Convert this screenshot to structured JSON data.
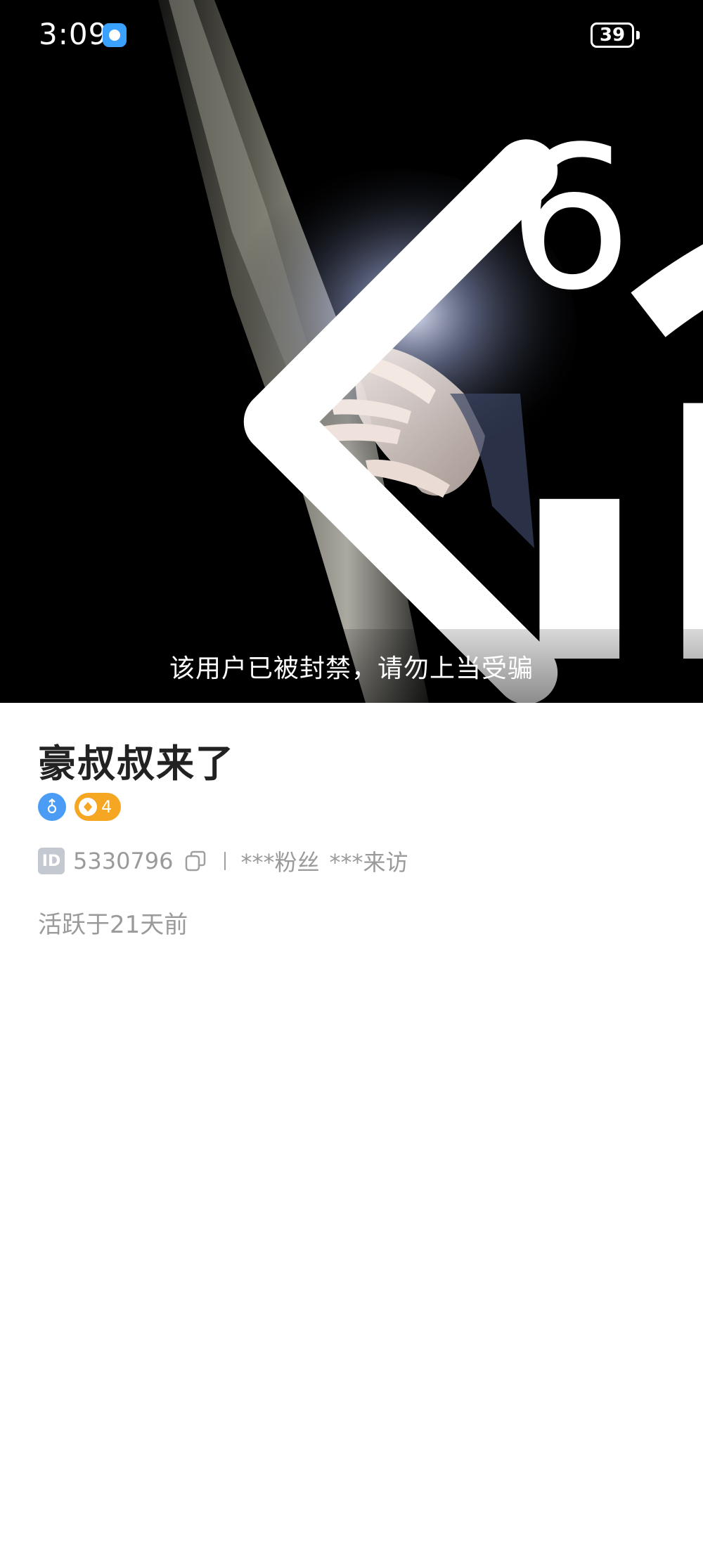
{
  "status_bar": {
    "time": "3:09",
    "network": "6",
    "battery": "39"
  },
  "profile": {
    "ban_notice": "该用户已被封禁，请勿上当受骗",
    "name": "豪叔叔来了",
    "level": "4",
    "id_label": "ID",
    "id_value": "5330796",
    "fans": "***粉丝",
    "visitors": "***来访",
    "active": "活跃于21天前"
  },
  "icons": [
    "back-icon",
    "more-icon",
    "copy-icon",
    "male-icon",
    "diamond-icon",
    "wifi-icon",
    "signal-icon",
    "battery-icon"
  ],
  "colors": {
    "gender_badge": "#4a9cf4",
    "level_badge": "#f5a623",
    "name_text": "#222222",
    "secondary_text": "#9a9a9a"
  }
}
